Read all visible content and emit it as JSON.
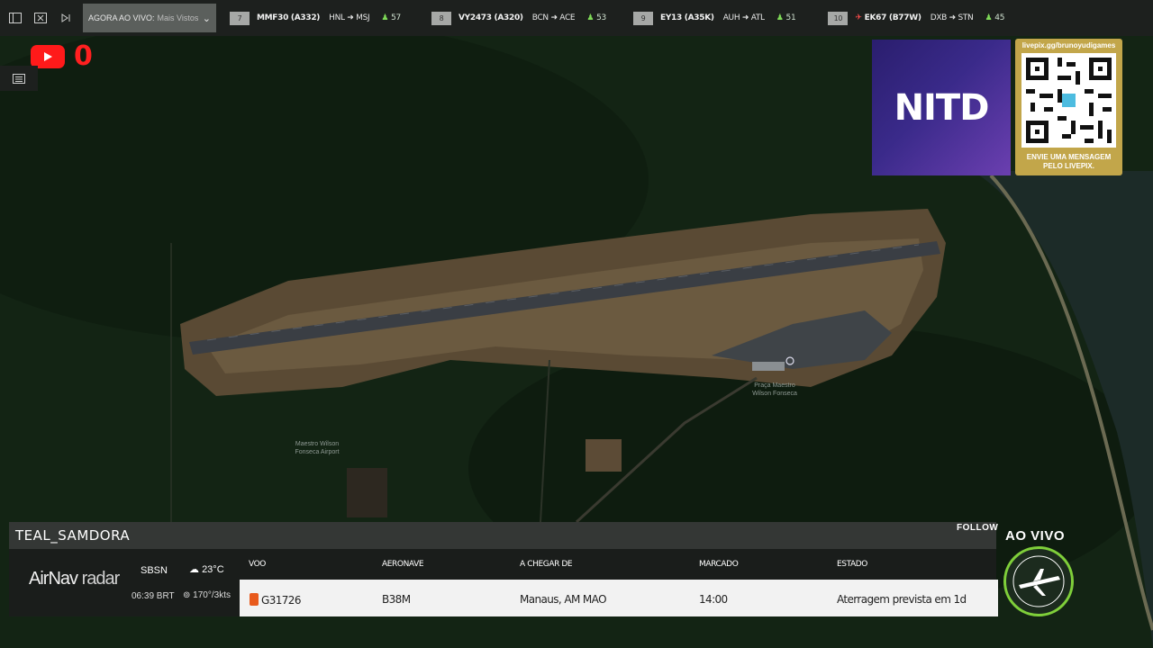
{
  "topbar": {
    "agora_label": "AGORA AO VIVO:",
    "agora_filter": "Mais Vistos",
    "flights": [
      {
        "num": "7",
        "code": "MMF30 (A332)",
        "route_from": "HNL",
        "route_to": "MSJ",
        "count": "57",
        "plane_color": "#7ed957"
      },
      {
        "num": "8",
        "code": "VY2473 (A320)",
        "route_from": "BCN",
        "route_to": "ACE",
        "count": "53",
        "plane_color": "#7ed957"
      },
      {
        "num": "9",
        "code": "EY13 (A35K)",
        "route_from": "AUH",
        "route_to": "ATL",
        "count": "51",
        "plane_color": "#7ed957"
      },
      {
        "num": "10",
        "code": "EK67 (B77W)",
        "route_from": "DXB",
        "route_to": "STN",
        "count": "45",
        "plane_color": "#ff4d4d"
      }
    ]
  },
  "youtube": {
    "count": "0"
  },
  "map": {
    "airport_label_1": "Maestro Wilson",
    "airport_label_2": "Fonseca Airport",
    "plaza_label_1": "Praça Maestro",
    "plaza_label_2": "Wilson Fonseca"
  },
  "sponsor": {
    "logo_text": "NITD",
    "qr_url": "livepix.gg/brunoyudigames",
    "qr_msg_1": "ENVIE UMA MENSAGEM",
    "qr_msg_2": "PELO LIVEPIX."
  },
  "panel": {
    "title": "TEAL_SAMDORA",
    "follow": "FOLLOW",
    "brand": "AirNav",
    "brand_suffix": "radar",
    "icao": "SBSN",
    "time": "06:39 BRT",
    "temp": "23°C",
    "wind": "170°/3kts",
    "headers": {
      "voo": "VOO",
      "aeronave": "AERONAVE",
      "chegar": "A CHEGAR DE",
      "marcado": "MARCADO",
      "estado": "ESTADO"
    },
    "row": {
      "voo": "G31726",
      "aeronave": "B38M",
      "chegar": "Manaus, AM MAO",
      "marcado": "14:00",
      "estado": "Aterragem prevista em 1d"
    }
  },
  "live": {
    "label": "AO VIVO"
  }
}
